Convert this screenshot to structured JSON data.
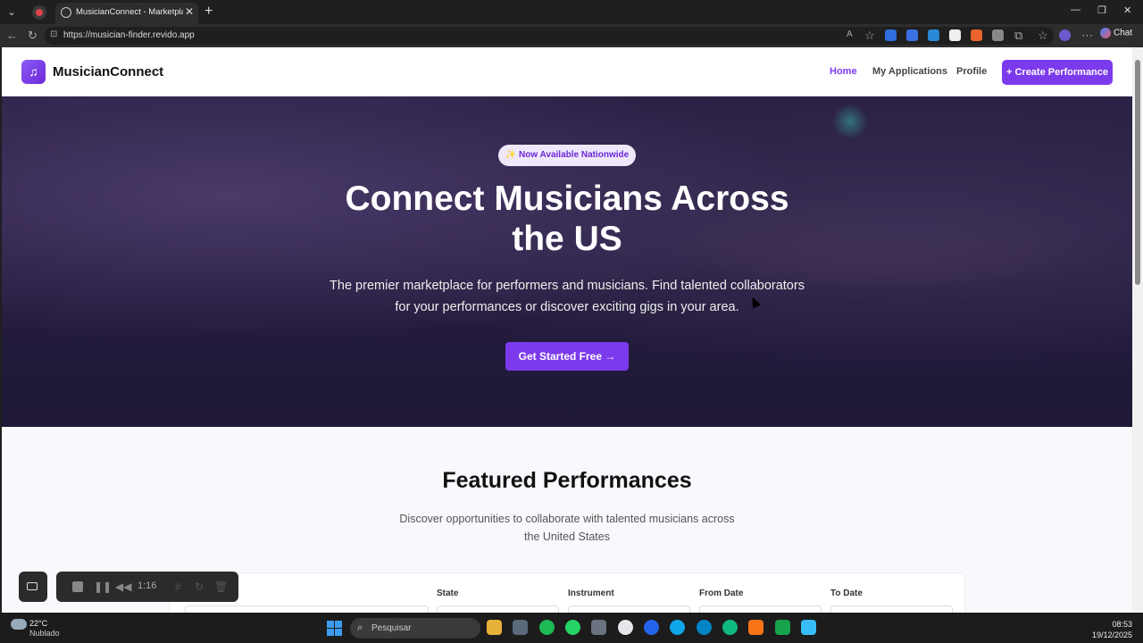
{
  "browser": {
    "tab_title": "MusicianConnect - Marketplace fo",
    "url": "https://musician-finder.revido.app",
    "chat_label": "Chat"
  },
  "site": {
    "brand": "MusicianConnect",
    "nav": {
      "home": "Home",
      "applications": "My Applications",
      "profile": "Profile",
      "create": "+ Create Performance"
    }
  },
  "hero": {
    "badge": "✨ Now Available Nationwide",
    "title_line1": "Connect Musicians Across",
    "title_line2": "the US",
    "subtitle_line1": "The premier marketplace for performers and musicians. Find talented collaborators",
    "subtitle_line2": "for your performances or discover exciting gigs in your area.",
    "cta": "Get Started Free →"
  },
  "featured": {
    "title": "Featured Performances",
    "subtitle_line1": "Discover opportunities to collaborate with talented musicians across",
    "subtitle_line2": "the United States",
    "filters": {
      "state": "State",
      "instrument": "Instrument",
      "from_date": "From Date",
      "to_date": "To Date"
    }
  },
  "recorder": {
    "time": "1:16"
  },
  "taskbar": {
    "weather_temp": "22°C",
    "weather_desc": "Nublado",
    "search_placeholder": "Pesquisar",
    "time": "08:53",
    "date": "19/12/2025"
  }
}
